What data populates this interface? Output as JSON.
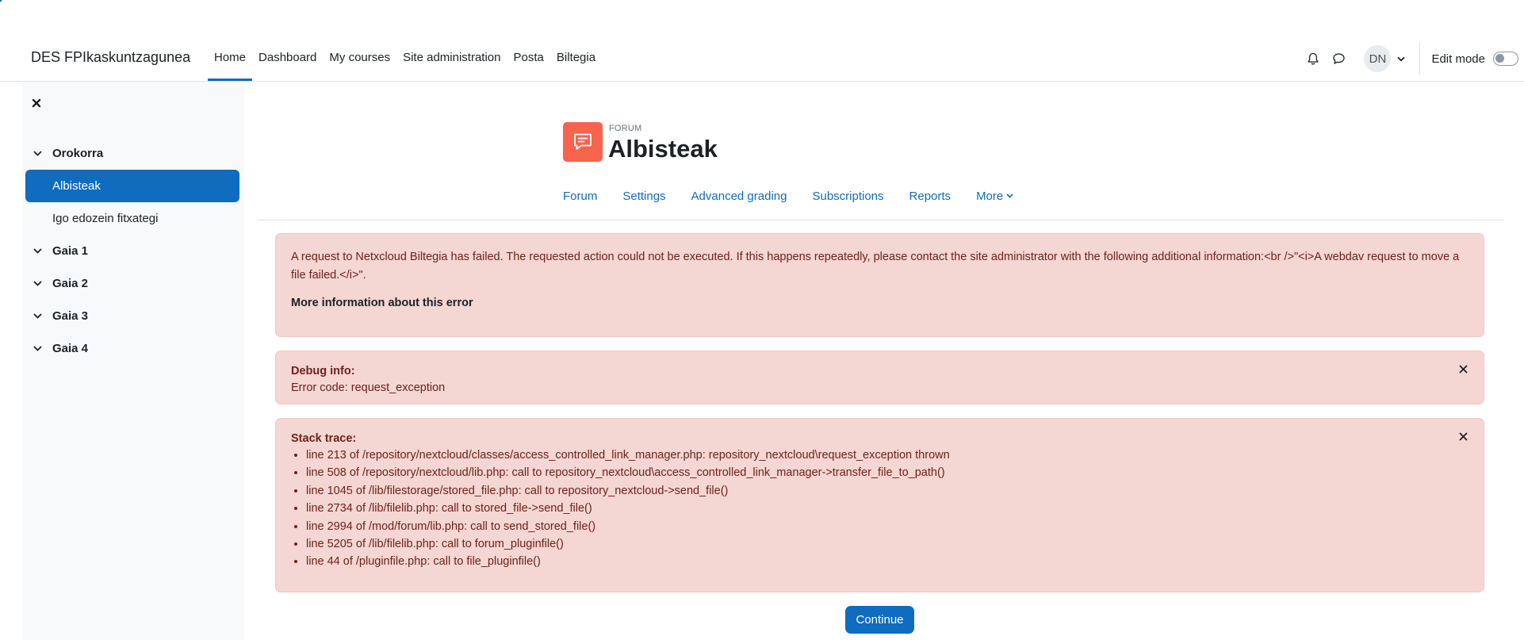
{
  "site_name": "DES FPIkaskuntzagunea",
  "primary_nav": [
    {
      "label": "Home",
      "active": true
    },
    {
      "label": "Dashboard"
    },
    {
      "label": "My courses"
    },
    {
      "label": "Site administration"
    },
    {
      "label": "Posta"
    },
    {
      "label": "Biltegia"
    }
  ],
  "user": {
    "initials": "DN"
  },
  "edit_mode": {
    "label": "Edit mode",
    "on": false
  },
  "course_index": {
    "sections": [
      {
        "label": "Orokorra",
        "items": [
          {
            "label": "Albisteak",
            "active": true
          },
          {
            "label": "Igo edozein fitxategi"
          }
        ]
      },
      {
        "label": "Gaia 1"
      },
      {
        "label": "Gaia 2"
      },
      {
        "label": "Gaia 3"
      },
      {
        "label": "Gaia 4"
      }
    ]
  },
  "header": {
    "module_type": "FORUM",
    "title": "Albisteak"
  },
  "secondary_nav": [
    "Forum",
    "Settings",
    "Advanced grading",
    "Subscriptions",
    "Reports",
    "More"
  ],
  "error": {
    "message": "A request to Netxcloud Biltegia has failed. The requested action could not be executed. If this happens repeatedly, please contact the site administrator with the following additional information:<br />\"<i>A webdav request to move a file failed.</i>\".",
    "more_info": "More information about this error"
  },
  "debug": {
    "heading": "Debug info:",
    "code": "Error code: request_exception"
  },
  "stack": {
    "heading": "Stack trace:",
    "lines": [
      "line 213 of /repository/nextcloud/classes/access_controlled_link_manager.php: repository_nextcloud\\request_exception thrown",
      "line 508 of /repository/nextcloud/lib.php: call to repository_nextcloud\\access_controlled_link_manager->transfer_file_to_path()",
      "line 1045 of /lib/filestorage/stored_file.php: call to repository_nextcloud->send_file()",
      "line 2734 of /lib/filelib.php: call to stored_file->send_file()",
      "line 2994 of /mod/forum/lib.php: call to send_stored_file()",
      "line 5205 of /lib/filelib.php: call to forum_pluginfile()",
      "line 44 of /pluginfile.php: call to file_pluginfile()"
    ]
  },
  "continue_label": "Continue",
  "colors": {
    "primary": "#0f6cbf",
    "alert_bg": "#f4d6d2",
    "alert_text": "#6e211a",
    "forum_icon": "#f7634d"
  }
}
